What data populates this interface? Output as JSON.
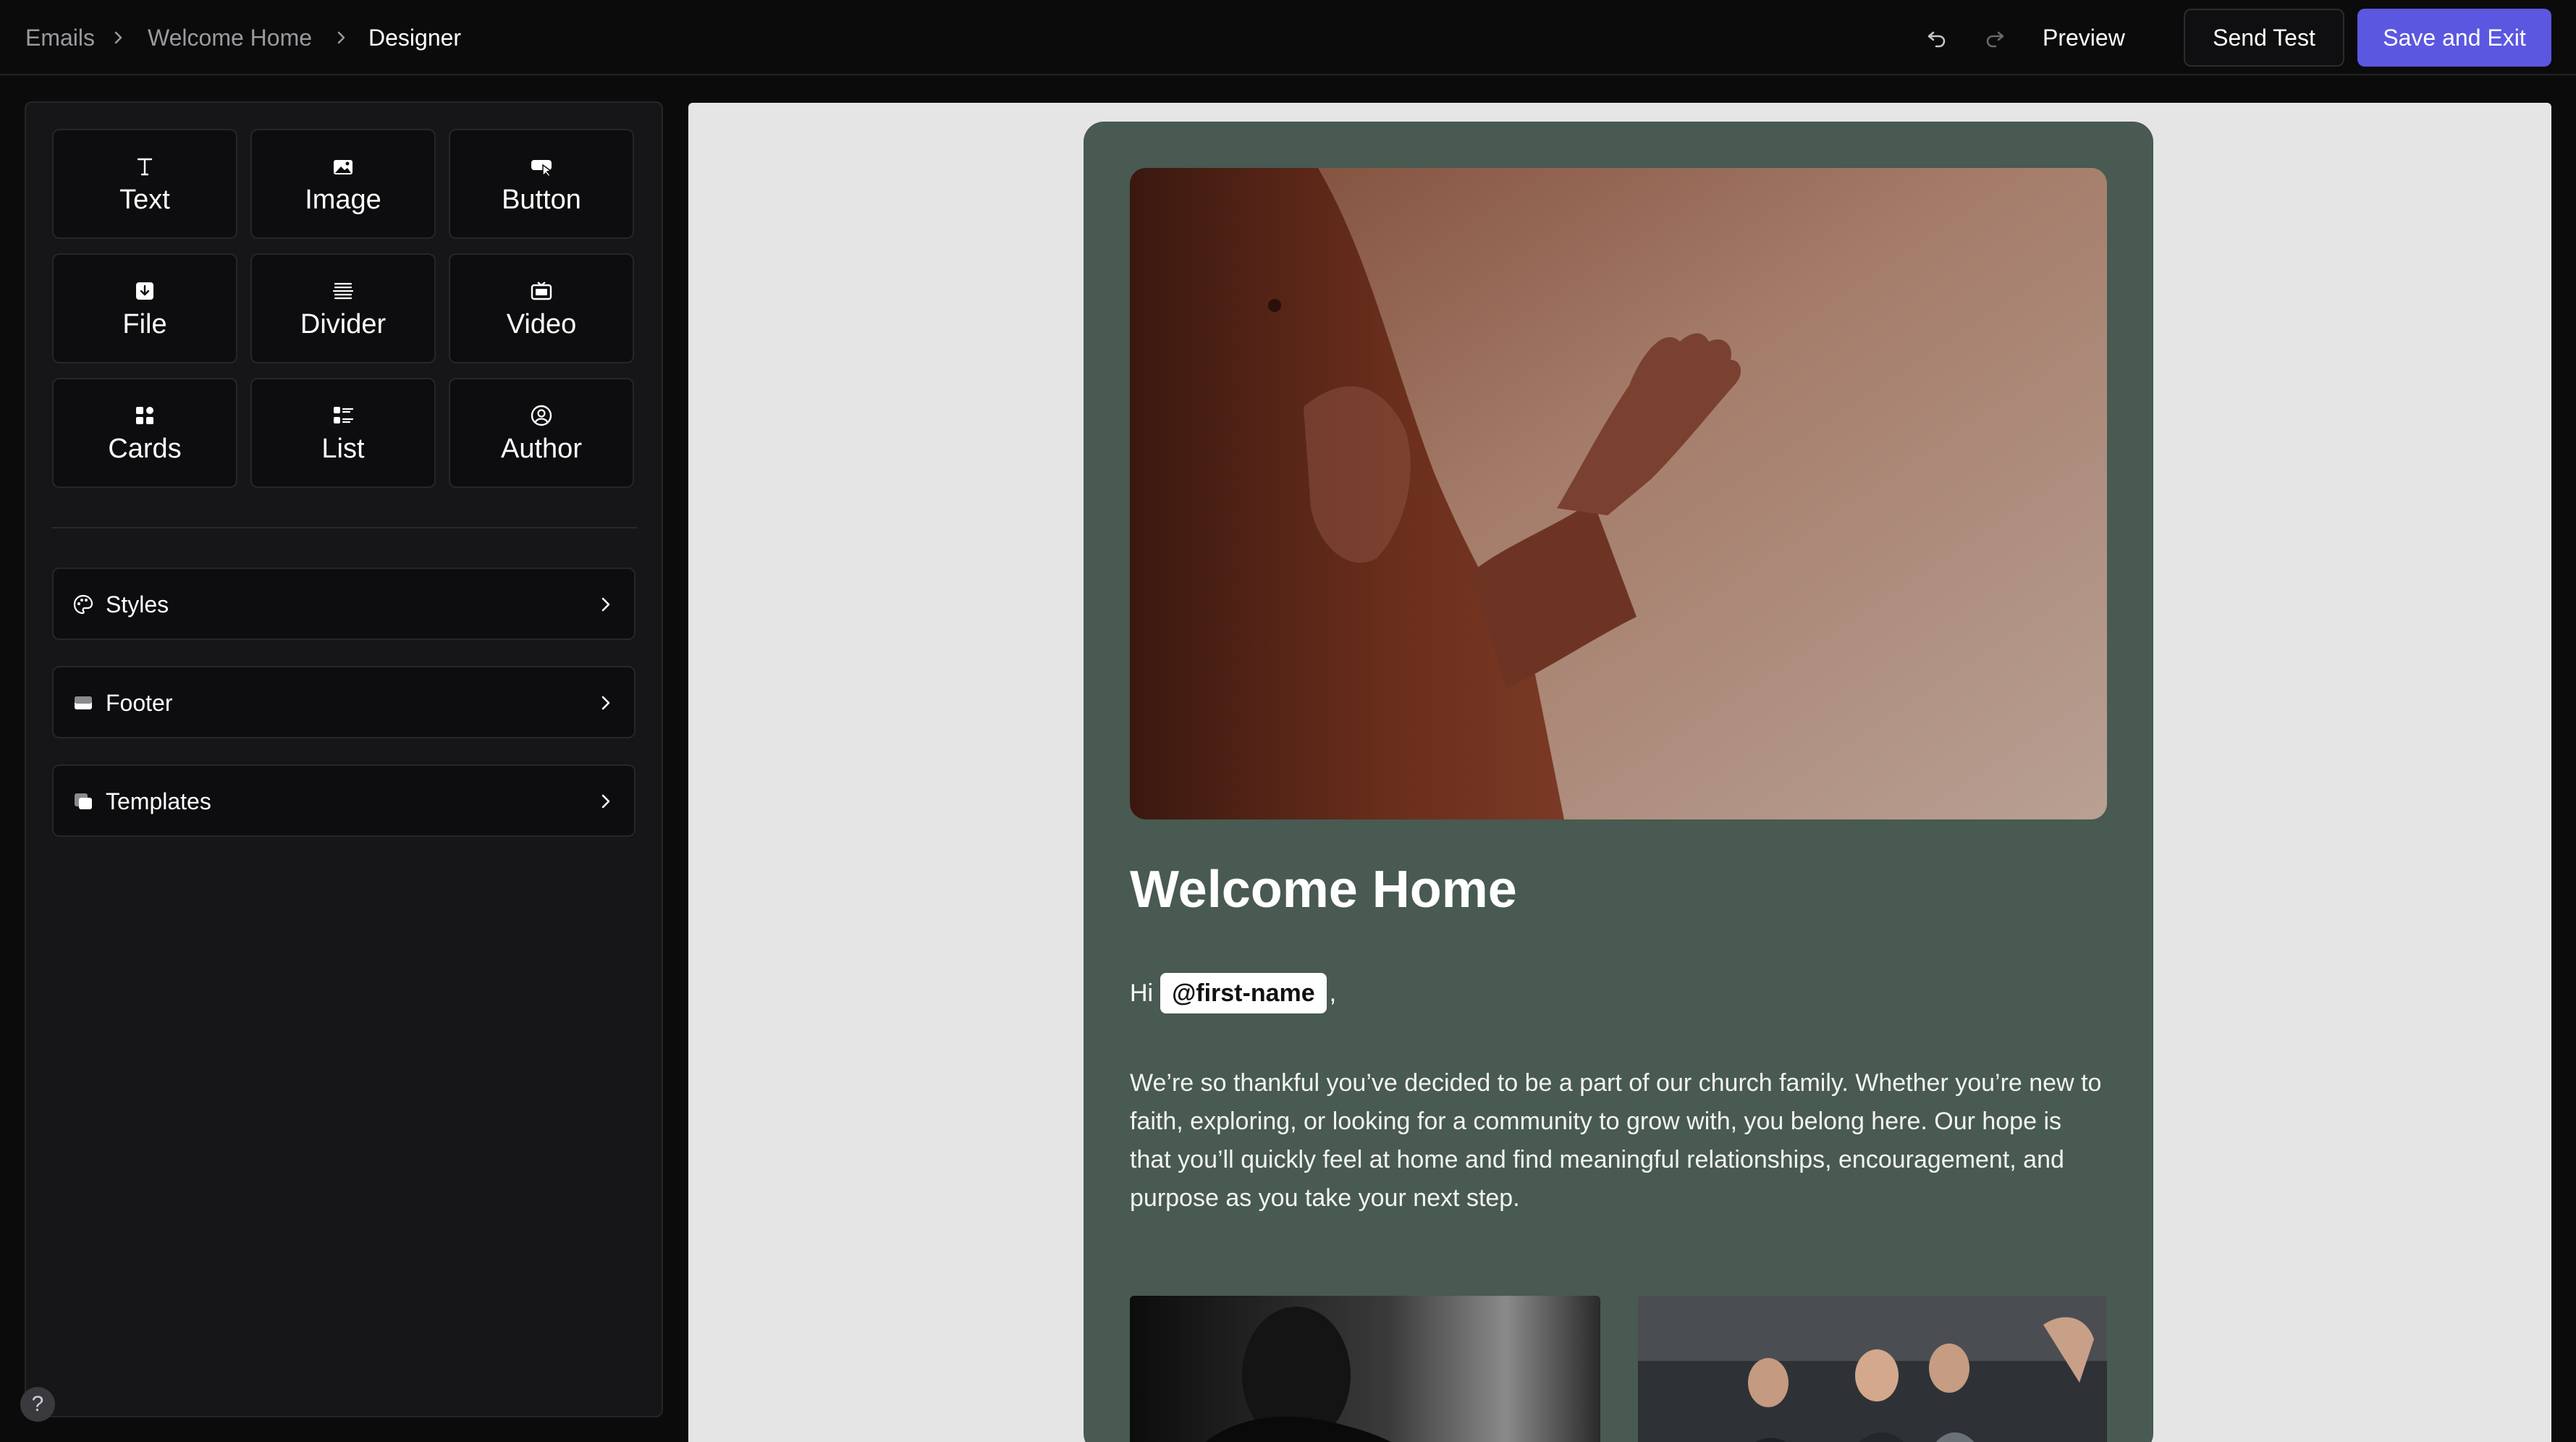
{
  "breadcrumb": {
    "items": [
      "Emails",
      "Welcome Home",
      "Designer"
    ]
  },
  "toolbar": {
    "preview_label": "Preview",
    "send_test_label": "Send Test",
    "save_exit_label": "Save and Exit",
    "accent_color": "#5b57e0"
  },
  "blocks": [
    {
      "label": "Text",
      "icon": "text-icon"
    },
    {
      "label": "Image",
      "icon": "image-icon"
    },
    {
      "label": "Button",
      "icon": "button-icon"
    },
    {
      "label": "File",
      "icon": "file-icon"
    },
    {
      "label": "Divider",
      "icon": "divider-icon"
    },
    {
      "label": "Video",
      "icon": "video-icon"
    },
    {
      "label": "Cards",
      "icon": "cards-icon"
    },
    {
      "label": "List",
      "icon": "list-icon"
    },
    {
      "label": "Author",
      "icon": "author-icon"
    }
  ],
  "panels": [
    {
      "label": "Styles",
      "icon": "palette-icon"
    },
    {
      "label": "Footer",
      "icon": "footer-icon"
    },
    {
      "label": "Templates",
      "icon": "templates-icon"
    }
  ],
  "help": {
    "label": "?"
  },
  "email": {
    "background_color": "#485a51",
    "title": "Welcome Home",
    "greeting_prefix": "Hi",
    "merge_tag": "@first-name",
    "greeting_suffix": ",",
    "body": "We’re so thankful you’ve decided to be a part of our church family. Whether you’re new to faith, exploring, or looking for a community to grow with, you belong here. Our hope is that you’ll quickly feel at home and find meaningful relationships, encouragement, and purpose as you take your next step."
  }
}
